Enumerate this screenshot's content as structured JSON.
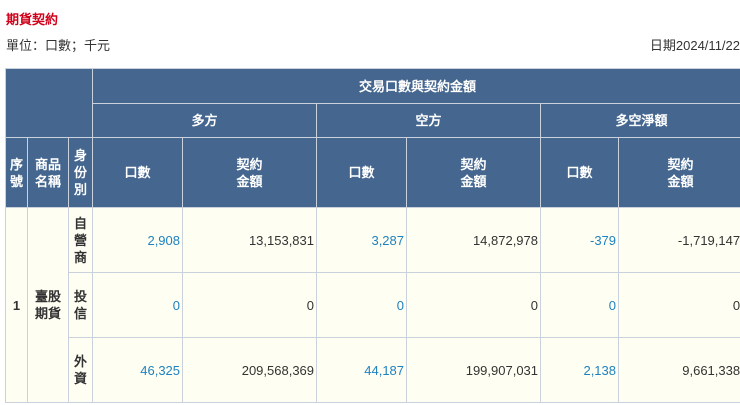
{
  "title": "期貨契約",
  "unit": "單位：口數；千元",
  "date": "日期2024/11/22",
  "header": {
    "group": "交易口數與契約金額",
    "long": "多方",
    "short": "空方",
    "net": "多空淨額",
    "seq": "序\n號",
    "product": "商品\n名稱",
    "identity": "身\n份\n別",
    "lots": "口數",
    "amount": "契約\n金額"
  },
  "rows": [
    {
      "seq": "1",
      "product": "臺股\n期貨",
      "identity": "自\n營\n商",
      "long_lots": "2,908",
      "long_amt": "13,153,831",
      "short_lots": "3,287",
      "short_amt": "14,872,978",
      "net_lots": "-379",
      "net_amt": "-1,719,147"
    },
    {
      "identity": "投\n信",
      "long_lots": "0",
      "long_amt": "0",
      "short_lots": "0",
      "short_amt": "0",
      "net_lots": "0",
      "net_amt": "0"
    },
    {
      "identity": "外\n資",
      "long_lots": "46,325",
      "long_amt": "209,568,369",
      "short_lots": "44,187",
      "short_amt": "199,907,031",
      "net_lots": "2,138",
      "net_amt": "9,661,338"
    }
  ]
}
